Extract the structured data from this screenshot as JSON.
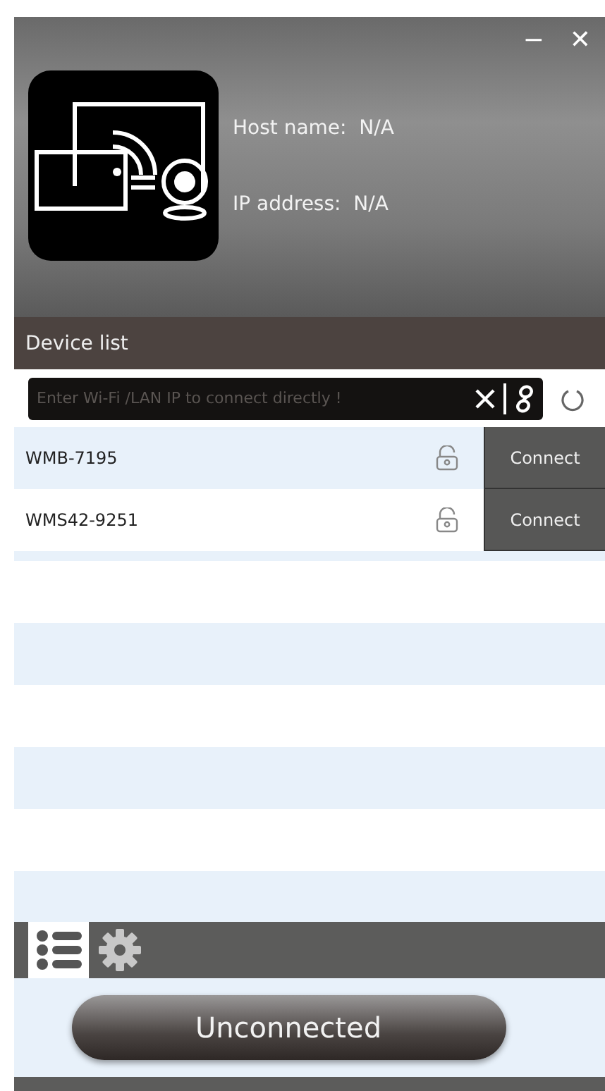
{
  "window": {
    "controls": [
      "−",
      "✕"
    ]
  },
  "host": {
    "host_name": "Host name:  N/A",
    "ip_address": "IP address:  N/A"
  },
  "device_list": {
    "title": "Device list",
    "search": {
      "placeholder": "Enter Wi-Fi /LAN IP to connect directly !"
    },
    "devices": [
      {
        "name": "WMB-7195",
        "button": "Connect"
      },
      {
        "name": "WMS42-9251",
        "button": "Connect"
      }
    ]
  },
  "tabs": [
    {
      "kind": "list",
      "selected": true
    },
    {
      "kind": "settings",
      "selected": false
    }
  ],
  "status_button": "Unconnected"
}
